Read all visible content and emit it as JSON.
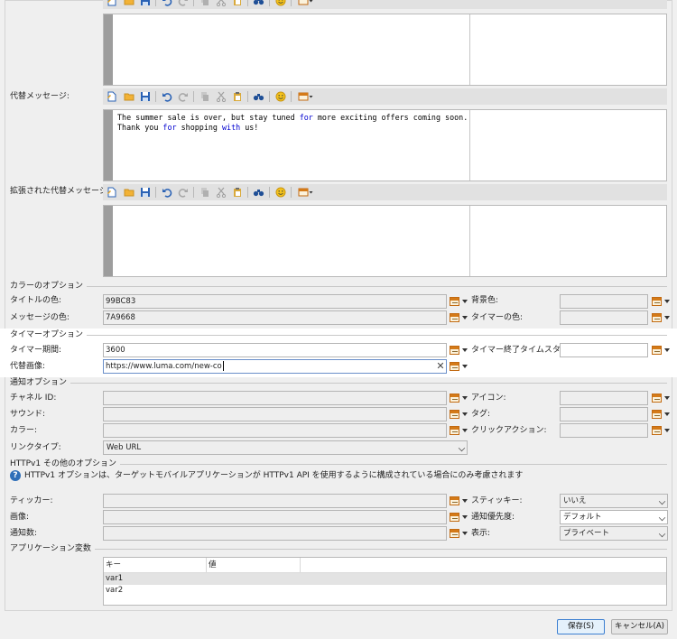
{
  "editor_toolbar": {
    "icons": [
      "new-file-icon",
      "open-folder-icon",
      "save-icon",
      "undo-icon",
      "redo-icon",
      "copy-icon",
      "cut-icon",
      "paste-icon",
      "find-icon",
      "emoji-icon",
      "insert-field-icon"
    ]
  },
  "alt_message": {
    "label": "代替メッセージ:",
    "line1_parts": [
      "The summer sale is over, but stay tuned ",
      "for",
      " more exciting offers coming soon."
    ],
    "line2_parts": [
      "Thank you ",
      "for",
      " shopping ",
      "with",
      " us!"
    ]
  },
  "extended_alt_message": {
    "label": "拡張された代替メッセージ:"
  },
  "color_options": {
    "section": "カラーのオプション",
    "title_color_label": "タイトルの色:",
    "title_color_value": "99BC83",
    "background_label": "背景色:",
    "message_color_label": "メッセージの色:",
    "message_color_value": "7A9668",
    "timer_color_label": "タイマーの色:"
  },
  "timer_options": {
    "section": "タイマーオプション",
    "duration_label": "タイマー期間:",
    "duration_value": "3600",
    "end_timestamp_label": "タイマー終了タイムスタンプ:",
    "alt_image_label": "代替画像:",
    "alt_image_value": "https://www.luma.com/new-co"
  },
  "notification_options": {
    "section": "通知オプション",
    "channel_id_label": "チャネル ID:",
    "icon_label": "アイコン:",
    "sound_label": "サウンド:",
    "tag_label": "タグ:",
    "color_label": "カラー:",
    "click_action_label": "クリックアクション:",
    "link_type_label": "リンクタイプ:",
    "link_type_value": "Web URL"
  },
  "httpv1": {
    "section": "HTTPv1 その他のオプション",
    "info_text": "HTTPv1 オプションは、ターゲットモバイルアプリケーションが HTTPv1 API を使用するように構成されている場合にのみ考慮されます",
    "ticker_label": "ティッカー:",
    "sticky_label": "スティッキー:",
    "sticky_value": "いいえ",
    "image_label": "画像:",
    "priority_label": "通知優先度:",
    "priority_value": "デフォルト",
    "count_label": "通知数:",
    "visibility_label": "表示:",
    "visibility_value": "プライベート"
  },
  "app_variables": {
    "section": "アプリケーション変数",
    "col_key": "キー",
    "col_value": "値",
    "rows": [
      {
        "key": "var1"
      },
      {
        "key": "var2"
      }
    ]
  },
  "footer": {
    "save_label": "保存(S)",
    "cancel_label": "キャンセル(A)"
  }
}
